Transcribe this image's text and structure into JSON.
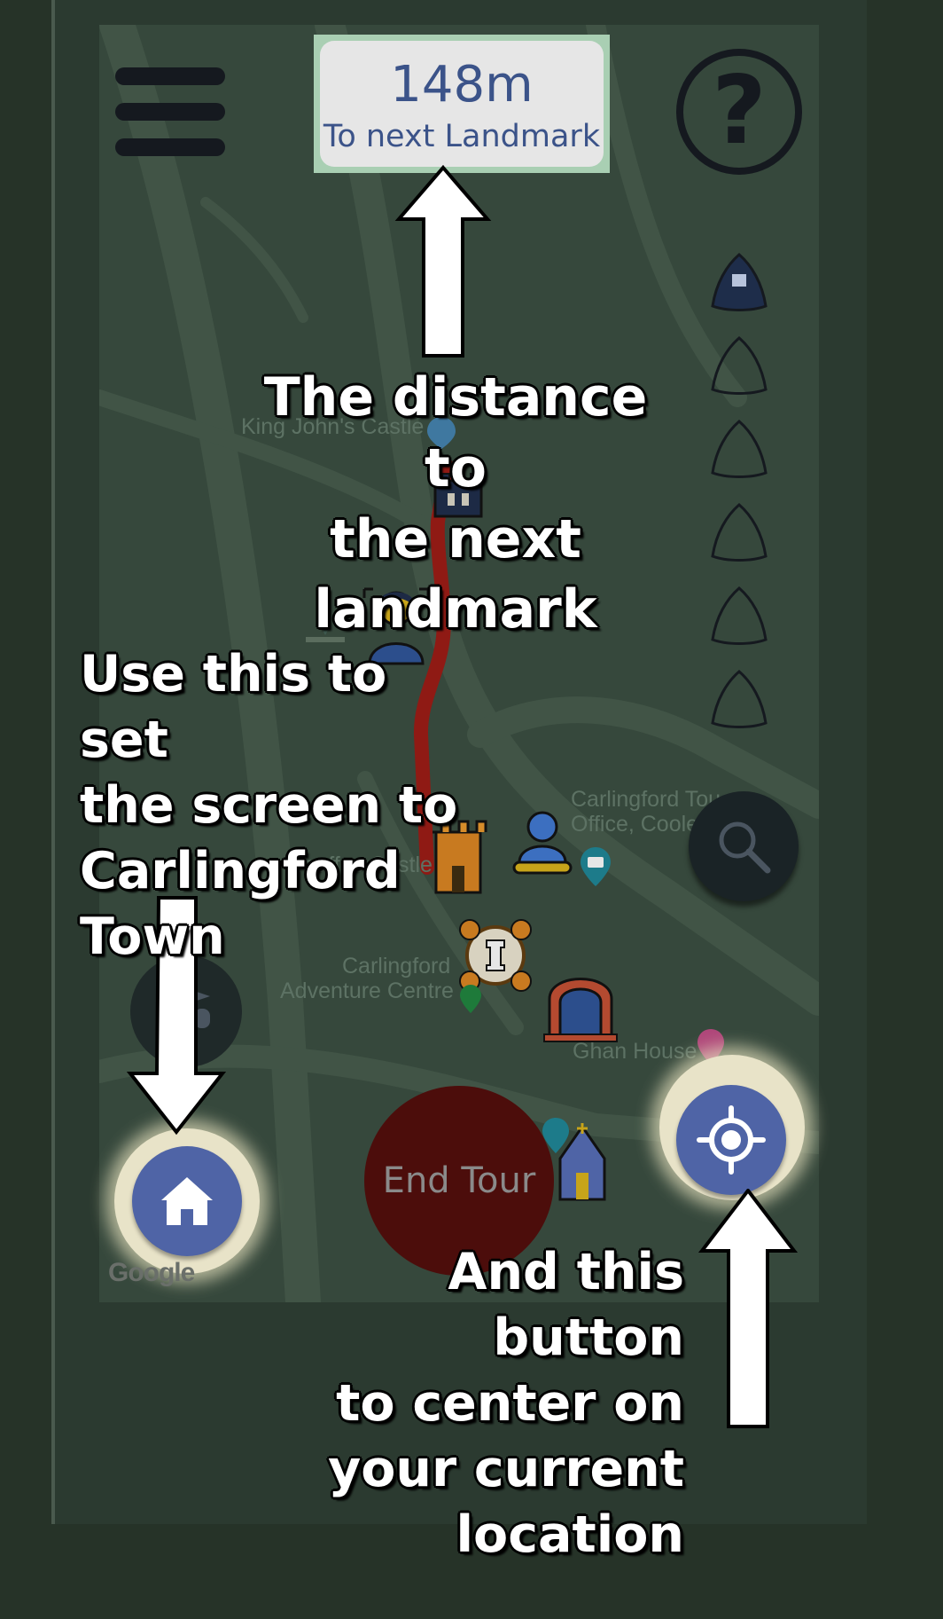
{
  "header": {
    "distance_value": "148m",
    "distance_caption": "To next Landmark"
  },
  "map": {
    "labels": {
      "castle": "King John's Castle",
      "tourist_office_line1": "Carlingford Tou",
      "tourist_office_line2": "Office, Coole",
      "taaffes": "Taaffes Castle",
      "adventure_line1": "Carlingford",
      "adventure_line2": "Adventure Centre",
      "ghan": "Ghan House"
    },
    "attribution": "Google"
  },
  "progress": {
    "total_landmarks": 6,
    "visited_landmarks": 1
  },
  "buttons": {
    "end_tour_label": "End Tour",
    "home_icon": "home-icon",
    "locate_icon": "crosshair-icon",
    "search_icon": "search-icon",
    "menu_icon": "menu-icon",
    "help_icon": "help-icon"
  },
  "annotations": {
    "distance": [
      "The distance to",
      "the next",
      "landmark"
    ],
    "home": [
      "Use this to set",
      "the screen to",
      "Carlingford",
      "Town"
    ],
    "locate": [
      "And this button",
      "to center on",
      "your current",
      "location"
    ]
  },
  "colors": {
    "accent_blue": "#4f64a6",
    "end_tour_red": "#4c0d0b",
    "route_red": "#8f1a14",
    "distance_text": "#3b5389"
  }
}
